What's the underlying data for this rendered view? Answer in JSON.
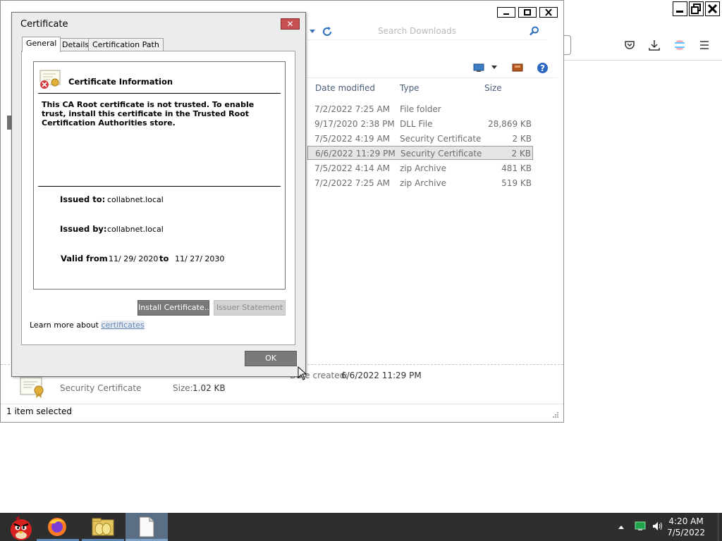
{
  "firefox": {
    "window_buttons": [
      "minimize-icon",
      "restore-icon",
      "close-icon"
    ],
    "toolbar_icons": [
      "pocket-icon",
      "download-icon",
      "extension-icon",
      "menu-icon"
    ]
  },
  "explorer": {
    "search_placeholder": "Search Downloads",
    "columns": {
      "date_modified": "Date modified",
      "type": "Type",
      "size": "Size"
    },
    "rows": [
      {
        "date": "7/2/2022 7:25 AM",
        "type": "File folder",
        "size": ""
      },
      {
        "date": "9/17/2020 2:38 PM",
        "type": "DLL File",
        "size": "28,869 KB"
      },
      {
        "date": "7/5/2022 4:19 AM",
        "type": "Security Certificate",
        "size": "2 KB"
      },
      {
        "date": "6/6/2022 11:29 PM",
        "type": "Security Certificate",
        "size": "2 KB",
        "selected": true
      },
      {
        "date": "7/5/2022 4:14 AM",
        "type": "zip Archive",
        "size": "481 KB"
      },
      {
        "date": "7/2/2022 7:25 AM",
        "type": "zip Archive",
        "size": "519 KB"
      }
    ],
    "details": {
      "type": "Security Certificate",
      "size_label": "Size:",
      "size_value": "1.02 KB",
      "created_label": "Date created:",
      "created_value": "6/6/2022 11:29 PM"
    },
    "status": "1 item selected"
  },
  "certificate": {
    "title": "Certificate",
    "close": "✕",
    "tabs": [
      "General",
      "Details",
      "Certification Path"
    ],
    "info_title": "Certificate Information",
    "warning": "This CA Root certificate is not trusted. To enable trust, install this certificate in the Trusted Root Certification Authorities store.",
    "issued_to_label": "Issued to:",
    "issued_to": "collabnet.local",
    "issued_by_label": "Issued by:",
    "issued_by": "collabnet.local",
    "valid_from_label": "Valid from",
    "valid_from": "11/ 29/ 2020",
    "to_label": "to",
    "valid_to": "11/ 27/ 2030",
    "install_button": "Install Certificate...",
    "issuer_button": "Issuer Statement",
    "learn_more": "Learn more about",
    "learn_link": "certificates",
    "ok_button": "OK"
  },
  "taskbar": {
    "apps": [
      "angry-birds-icon",
      "firefox-icon",
      "file-explorer-icon",
      "document-icon"
    ],
    "time": "4:20 AM",
    "date": "7/5/2022"
  },
  "colors": {
    "close_red": "#c75050",
    "taskbar": "#2e2e2e",
    "link": "#6b8ab4"
  }
}
